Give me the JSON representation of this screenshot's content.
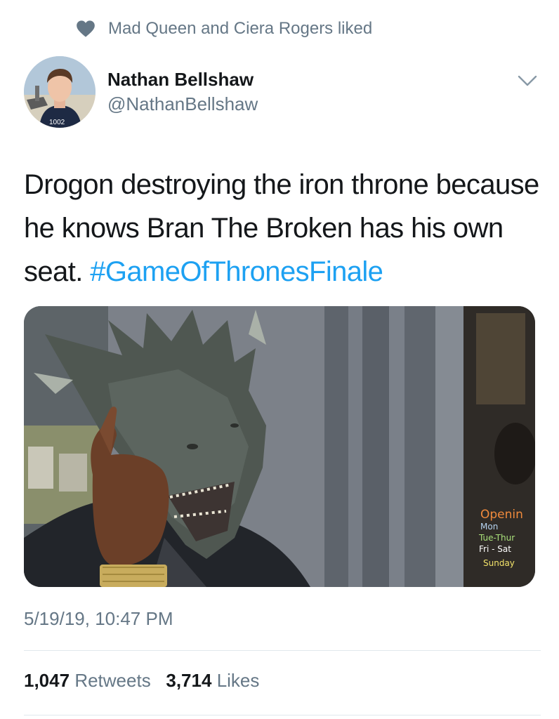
{
  "social_context": {
    "text": "Mad Queen and Ciera Rogers liked",
    "icon": "heart-icon"
  },
  "author": {
    "name": "Nathan Bellshaw",
    "handle": "@NathanBellshaw",
    "avatar_text": "1002"
  },
  "tweet": {
    "text": "Drogon destroying the iron throne because he knows Bran The Broken has his own seat.",
    "hashtag": "#GameOfThronesFinale"
  },
  "media": {
    "sign_lines": [
      "Openin",
      "Mon",
      "Tue-Thur",
      "Fri - Sat",
      "Sunday"
    ]
  },
  "timestamp": "5/19/19, 10:47 PM",
  "stats": {
    "retweets_count": "1,047",
    "retweets_label": "Retweets",
    "likes_count": "3,714",
    "likes_label": "Likes"
  },
  "colors": {
    "link": "#1da1f2",
    "secondary_text": "#657786",
    "primary_text": "#14171a",
    "divider": "#e1e8ed"
  }
}
